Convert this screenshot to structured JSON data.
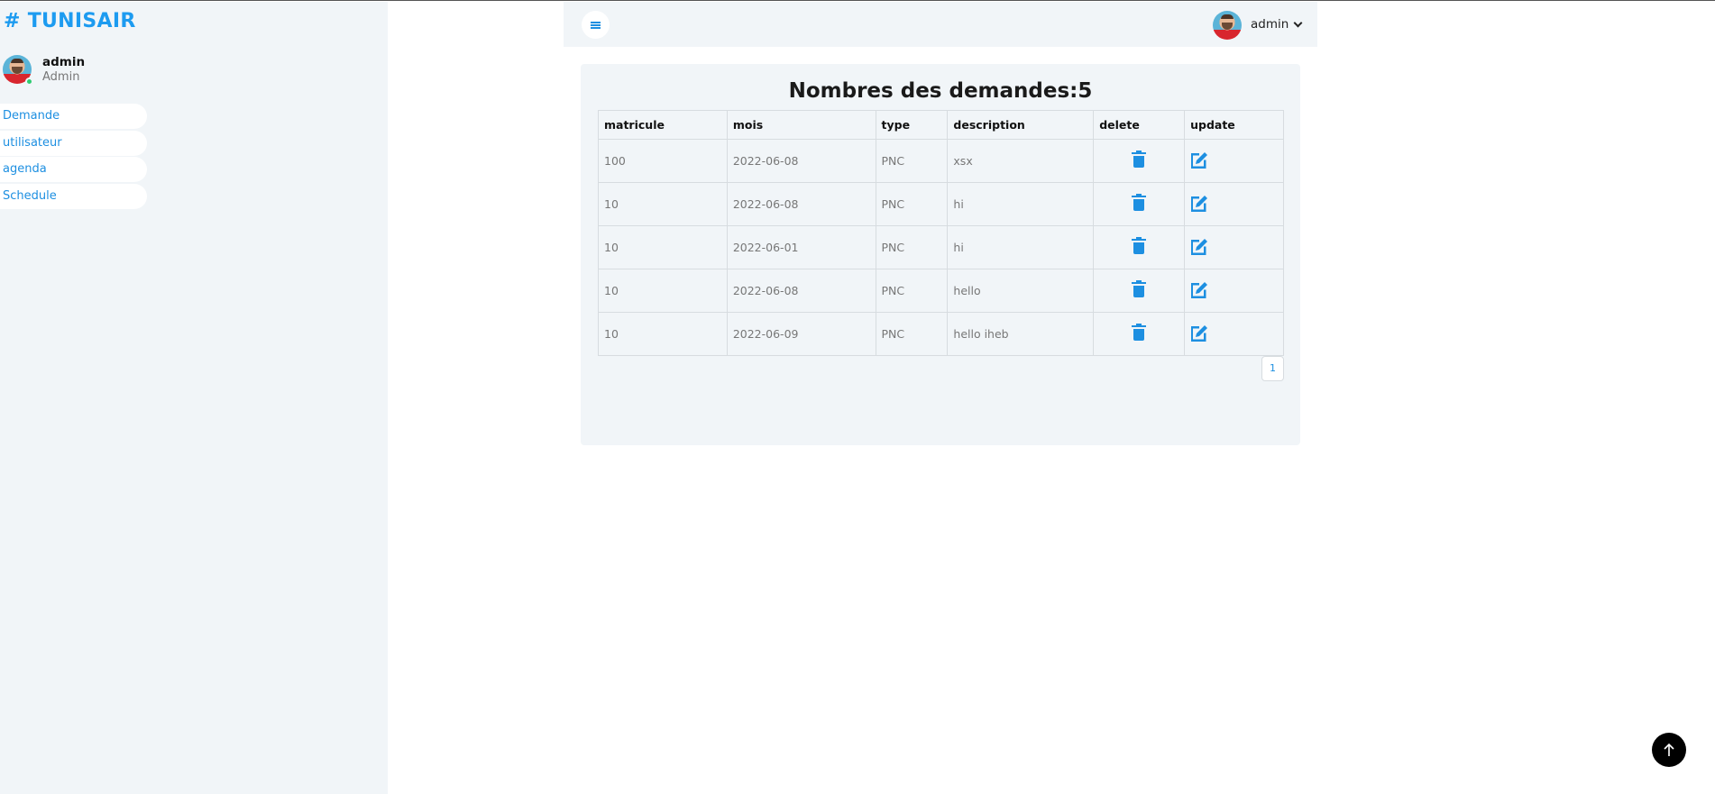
{
  "sidebar": {
    "brand": "# TUNISAIR",
    "profile": {
      "name": "admin",
      "role": "Admin"
    },
    "items": [
      {
        "label": "Demande"
      },
      {
        "label": "utilisateur"
      },
      {
        "label": "agenda"
      },
      {
        "label": "Schedule"
      }
    ]
  },
  "header": {
    "user_name": "admin"
  },
  "main": {
    "title": "Nombres des demandes:5",
    "columns": [
      "matricule",
      "mois",
      "type",
      "description",
      "delete",
      "update"
    ],
    "rows": [
      {
        "matricule": "100",
        "mois": "2022-06-08",
        "type": "PNC",
        "description": "xsx"
      },
      {
        "matricule": "10",
        "mois": "2022-06-08",
        "type": "PNC",
        "description": "hi"
      },
      {
        "matricule": "10",
        "mois": "2022-06-01",
        "type": "PNC",
        "description": "hi"
      },
      {
        "matricule": "10",
        "mois": "2022-06-08",
        "type": "PNC",
        "description": "hello"
      },
      {
        "matricule": "10",
        "mois": "2022-06-09",
        "type": "PNC",
        "description": "hello iheb"
      }
    ],
    "pagination": {
      "current": "1"
    }
  },
  "icons": {
    "menu": "hamburger-icon",
    "delete": "trash-icon",
    "update": "edit-icon",
    "chevron": "chevron-down-icon",
    "scroll_top": "arrow-up-icon"
  },
  "colors": {
    "accent": "#1d8fe1",
    "brand": "#1d9bf0",
    "online": "#2ecc71",
    "panel_bg": "#f1f5f8"
  }
}
